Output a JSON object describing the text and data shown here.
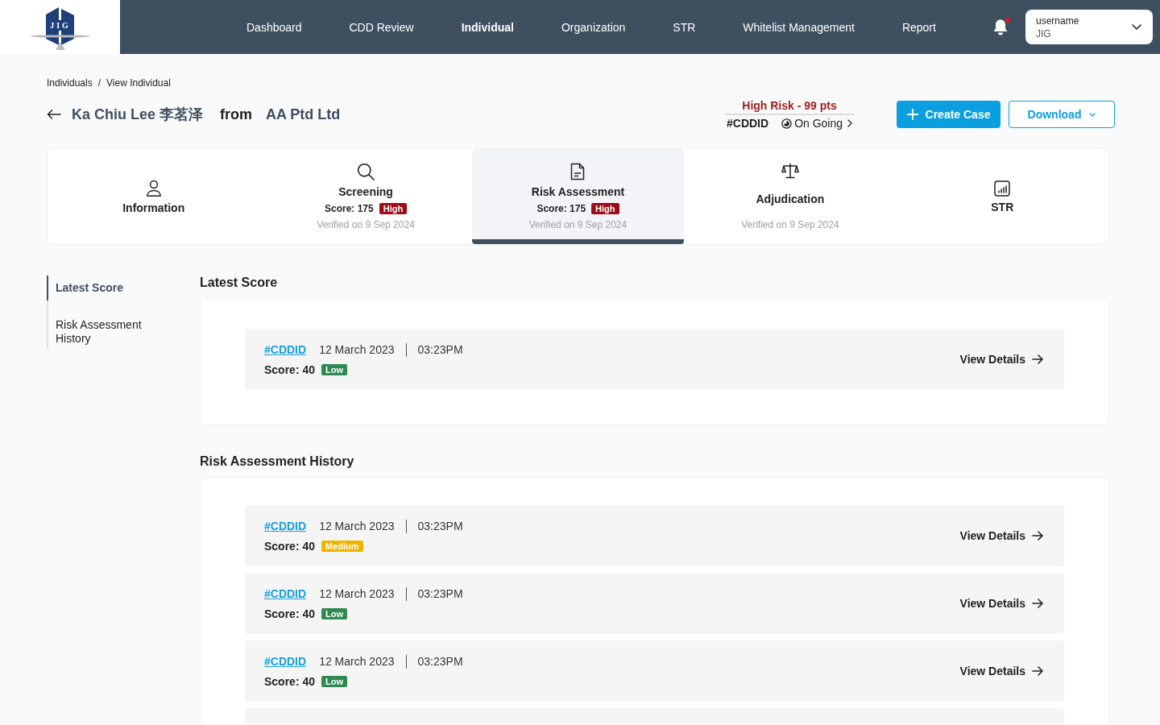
{
  "logo": {
    "text": "JIG"
  },
  "nav": {
    "items": [
      {
        "label": "Dashboard",
        "selected": false
      },
      {
        "label": "CDD Review",
        "selected": false
      },
      {
        "label": "Individual",
        "selected": true
      },
      {
        "label": "Organization",
        "selected": false
      },
      {
        "label": "STR",
        "selected": false
      },
      {
        "label": "Whitelist Management",
        "selected": false
      },
      {
        "label": "Report",
        "selected": false
      }
    ],
    "notifications": {
      "unread": true
    },
    "user": {
      "name": "username",
      "org": "JIG"
    }
  },
  "breadcrumb": {
    "items": [
      "Individuals",
      "View Individual"
    ],
    "separator": "/"
  },
  "header": {
    "name": "Ka Chiu Lee 李茗泽",
    "connector": "from",
    "organization": "AA Ptd Ltd",
    "risk": "High Risk - 99 pts",
    "case_id": "#CDDID",
    "case_status": "On Going",
    "actions": [
      {
        "label": "Create Case",
        "kind": "primary"
      },
      {
        "label": "Download",
        "kind": "dropdown"
      }
    ]
  },
  "tabs": [
    {
      "label": "Information",
      "selected": false
    },
    {
      "label": "Screening",
      "score": "Score: 175",
      "badge": {
        "text": "High",
        "color": "#9b0d18"
      },
      "verified": "Verified on 9 Sep 2024",
      "selected": false
    },
    {
      "label": "Risk Assessment",
      "score": "Score: 175",
      "badge": {
        "text": "High",
        "color": "#9b0d18"
      },
      "verified": "Verified on 9 Sep 2024",
      "selected": true
    },
    {
      "label": "Adjudication",
      "verified": "Verified on 9 Sep 2024",
      "selected": false
    },
    {
      "label": "STR",
      "selected": false
    }
  ],
  "side_nav": [
    {
      "label": "Latest Score",
      "selected": true
    },
    {
      "label": "Risk Assessment History",
      "selected": false
    }
  ],
  "latest": {
    "title": "Latest Score",
    "rows": [
      {
        "id": "#CDDID",
        "date": "12 March 2023",
        "time": "03:23PM",
        "score": "Score: 40",
        "badge": {
          "text": "Low",
          "color": "#2f8a52"
        },
        "action": "View Details"
      }
    ]
  },
  "history": {
    "title": "Risk Assessment History",
    "rows": [
      {
        "id": "#CDDID",
        "date": "12 March 2023",
        "time": "03:23PM",
        "score": "Score: 40",
        "badge": {
          "text": "Medium",
          "color": "#f0b400"
        },
        "action": "View Details"
      },
      {
        "id": "#CDDID",
        "date": "12 March 2023",
        "time": "03:23PM",
        "score": "Score: 40",
        "badge": {
          "text": "Low",
          "color": "#2f8a52"
        },
        "action": "View Details"
      },
      {
        "id": "#CDDID",
        "date": "12 March 2023",
        "time": "03:23PM",
        "score": "Score: 40",
        "badge": {
          "text": "Low",
          "color": "#2f8a52"
        },
        "action": "View Details"
      }
    ],
    "more_below": true
  }
}
